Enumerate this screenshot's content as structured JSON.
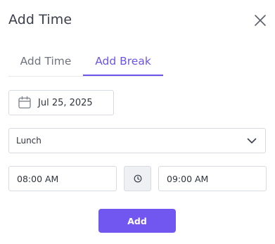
{
  "dialog": {
    "title": "Add Time",
    "close_icon": "close-icon"
  },
  "tabs": [
    {
      "label": "Add Time",
      "active": false
    },
    {
      "label": "Add Break",
      "active": true
    }
  ],
  "form": {
    "date": {
      "value": "Jul 25, 2025",
      "icon": "calendar-icon"
    },
    "break_type": {
      "value": "Lunch",
      "icon": "chevron-down-icon"
    },
    "start_time": {
      "value": "08:00 AM"
    },
    "clock_icon": "clock-icon",
    "end_time": {
      "value": "09:00 AM"
    }
  },
  "actions": {
    "add_label": "Add"
  },
  "colors": {
    "accent": "#6b55e8",
    "button": "#7157f0",
    "border": "#d8dbe0",
    "text": "#3a3f4b"
  }
}
